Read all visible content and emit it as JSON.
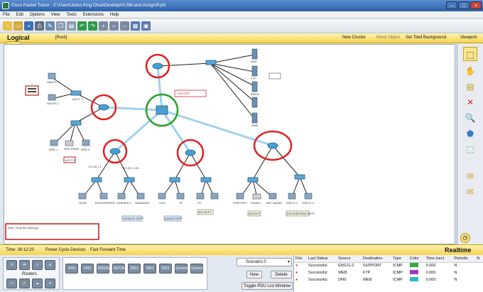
{
  "window": {
    "title": "Cisco Packet Tracer - C:\\Users\\Julius King Chua\\Desktop\\VLSM-and-Assign\\P.pkt"
  },
  "menu": [
    "File",
    "Edit",
    "Options",
    "View",
    "Tools",
    "Extensions",
    "Help"
  ],
  "subbar": {
    "logical": "Logical",
    "root": "[Root]",
    "new_cluster": "New Cluster",
    "move_object": "Move Object",
    "set_tiled_background": "Set Tiled Background",
    "viewport": "Viewport"
  },
  "status": {
    "time": "Time: 26:12:20",
    "power_cycle": "Power Cycle Devices",
    "fast_forward": "Fast Forward Time",
    "realtime": "Realtime"
  },
  "devices_panel": {
    "category_label": "Routers",
    "models": [
      "1841",
      "1941",
      "2620XM",
      "2621XM",
      "2811",
      "2901",
      "2911",
      "Generic",
      "Generic"
    ]
  },
  "scenario": {
    "selected": "Scenario 0",
    "new_label": "New",
    "delete_label": "Delete",
    "toggle_label": "Toggle PDU List Window"
  },
  "pdu": {
    "headers": [
      "Fire",
      "Last Status",
      "Source",
      "Destination",
      "Type",
      "Color",
      "Time (sec)",
      "Periodic",
      "N"
    ],
    "rows": [
      {
        "status": "Successful",
        "source": "ENG'G-2",
        "destination": "SUPPORT",
        "type": "ICMP",
        "color": "#33aa44",
        "time": "0.000",
        "periodic": "N"
      },
      {
        "status": "Successful",
        "source": "WEB",
        "destination": "FTP",
        "type": "ICMP",
        "color": "#9b3ac2",
        "time": "0.000",
        "periodic": "N"
      },
      {
        "status": "Successful",
        "source": "DNS",
        "destination": "WEB",
        "type": "ICMP",
        "color": "#2ab7c9",
        "time": "0.000",
        "periodic": "N"
      }
    ]
  },
  "labels": {
    "ip1": "172.20.1.1",
    "ip2": "172.20.1.129",
    "n_web": "WEB",
    "n_dns": "DNS",
    "n_ftp": "FTP",
    "n_email": "EMAIL",
    "n_sales1": "SALES-1",
    "n_sales2": "SALES-2",
    "n_hrd1": "HRD-1",
    "n_hrd2": "HRD-2",
    "n_hrdprint": "HRD-PRINT",
    "n_acct1": "ACCT-1",
    "n_acct2": "ACCT-2",
    "n_head": "HEAD",
    "n_bookkeeper": "BOOKKEEPER",
    "n_cashier": "CASHIER-1",
    "n_manager": "MANAGER",
    "n_ceo": "CEO",
    "n_vp": "VP",
    "n_support": "SUPPORT",
    "n_printer1": "Printer1",
    "n_netadmin": "NET ADMIN",
    "n_engg1": "ENG'G-1",
    "n_engg2": "ENG'G-2",
    "n_pc": "PC",
    "n_router": "ROUTER",
    "z_finance": "FINANCE DEPT",
    "z_admin": "ADMIN DEPT",
    "z_mis": "MIS DEPT",
    "z_it": "INSIGHT",
    "z_eng": "ENGINEERING DEPT",
    "note": "Note: Tests the topology ..."
  }
}
